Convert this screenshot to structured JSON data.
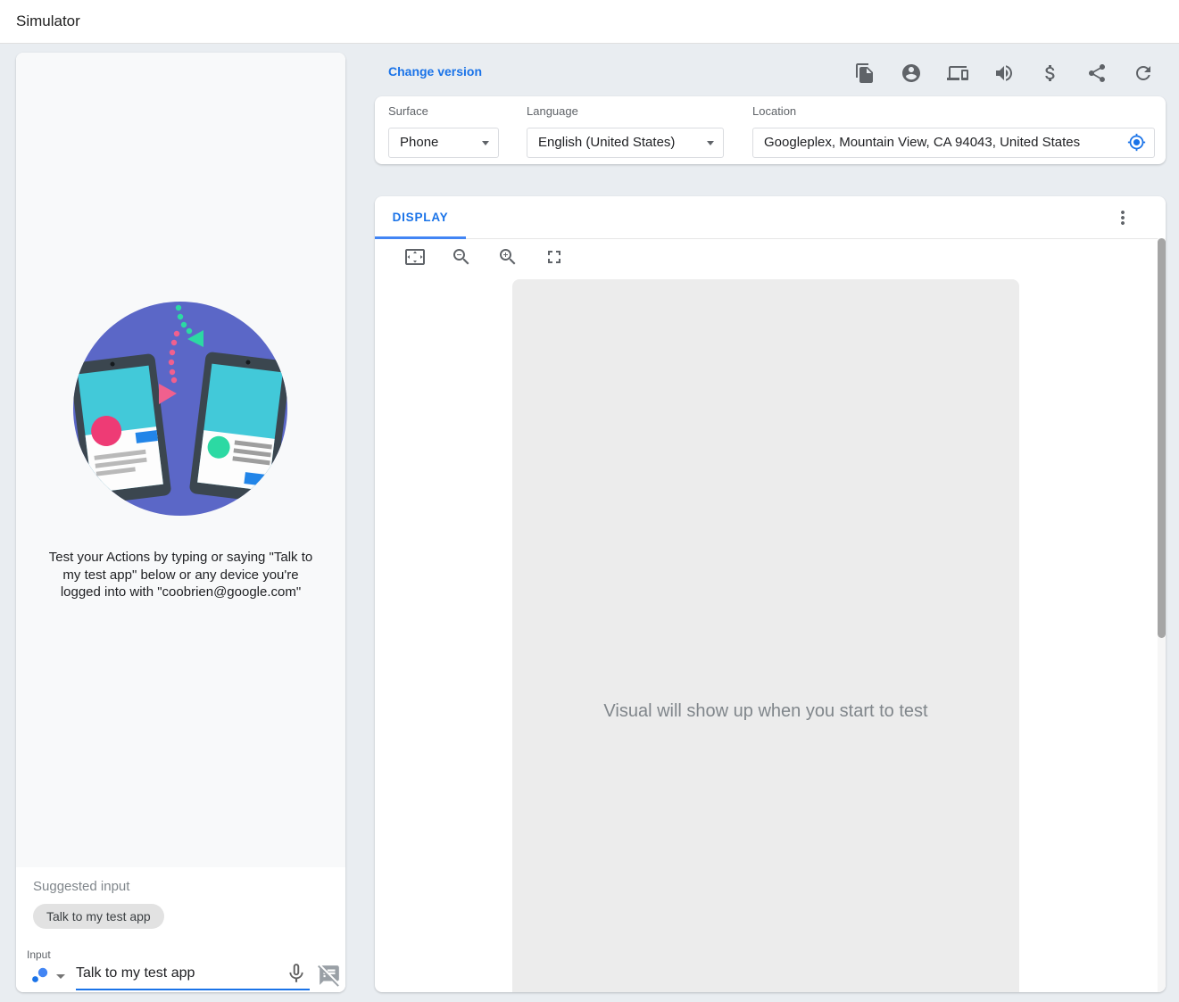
{
  "header": {
    "title": "Simulator"
  },
  "toolbar": {
    "change_version_label": "Change version",
    "icons": [
      "copy",
      "account",
      "devices",
      "volume-up",
      "attach-money",
      "share",
      "refresh"
    ]
  },
  "settings": {
    "surface": {
      "label": "Surface",
      "value": "Phone"
    },
    "language": {
      "label": "Language",
      "value": "English (United States)"
    },
    "location": {
      "label": "Location",
      "value": "Googleplex, Mountain View, CA 94043, United States",
      "icon": "my-location"
    }
  },
  "display": {
    "tab_label": "DISPLAY",
    "menu_icon": "more-vert",
    "toolbar_icons": [
      "settings-overscan",
      "zoom-out",
      "zoom-in",
      "fullscreen"
    ],
    "placeholder": "Visual will show up when you start to test"
  },
  "left": {
    "illustration": "two-phones-in-circle",
    "description": "Test your Actions by typing or saying \"Talk to my test app\" below or any device you're logged into with \"coobrien@google.com\"",
    "suggested_label": "Suggested input",
    "chip_label": "Talk to my test app",
    "input_label": "Input",
    "input_value": "Talk to my test app",
    "input_icons": [
      "assistant",
      "dropdown-caret",
      "mic",
      "speaker-notes-off"
    ]
  },
  "colors": {
    "accent_blue": "#1a73e8",
    "icon_gray": "#5f6368",
    "placeholder_gray": "#80868b",
    "illustration_circle": "#5b67c7",
    "illustration_phone": "#3b464f",
    "illustration_screen": "#42c9d9",
    "illustration_pink": "#ee3b75",
    "illustration_green": "#2cd9a3",
    "illustration_blue": "#2285e8"
  }
}
